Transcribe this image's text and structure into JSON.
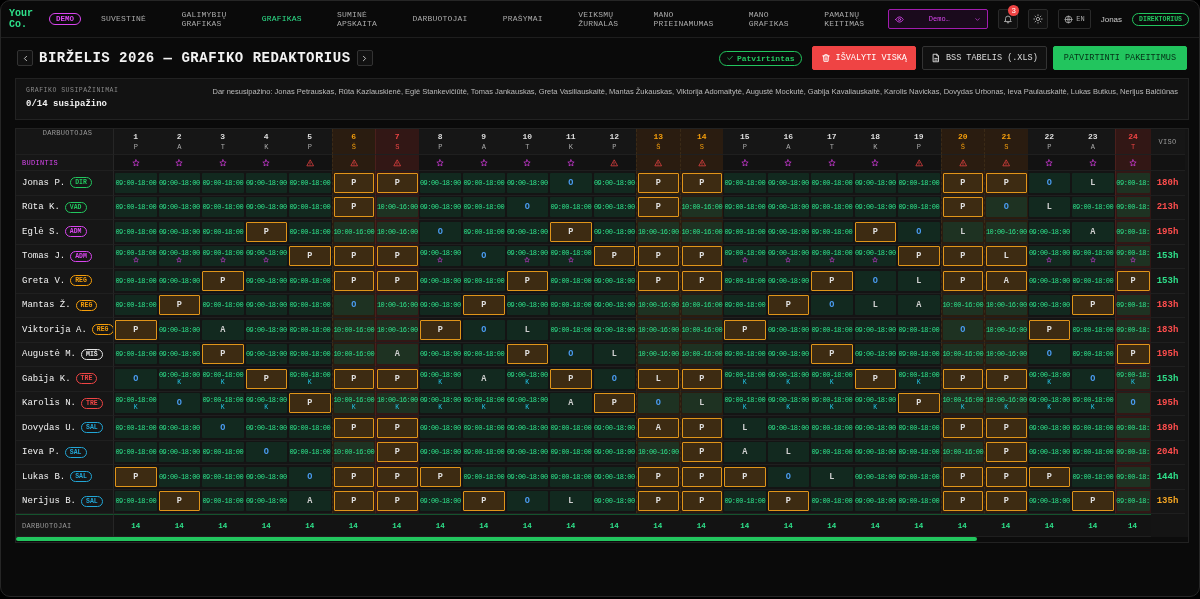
{
  "nav": {
    "logo": "Your Co.",
    "demo_badge": "DEMO",
    "items": [
      {
        "label": "SUVESTINĖ",
        "selected": false
      },
      {
        "label": "GALIMYBIŲ GRAFIKAS",
        "selected": false
      },
      {
        "label": "GRAFIKAS",
        "selected": true
      },
      {
        "label": "SUMINĖ APSKAITA",
        "selected": false
      },
      {
        "label": "DARBUOTOJAI",
        "selected": false
      },
      {
        "label": "PRAŠYMAI",
        "selected": false
      },
      {
        "label": "VEIKSMŲ ŽURNALAS",
        "selected": false
      },
      {
        "label": "MANO PRIEINAMUMAS",
        "selected": false
      },
      {
        "label": "MANO GRAFIKAS",
        "selected": false
      },
      {
        "label": "PAMAINŲ KEITIMAS",
        "selected": false
      }
    ],
    "workspace": "Demo…",
    "notifications": "3",
    "language": "EN",
    "user": "Jonas",
    "role": "DIREKTORIUS"
  },
  "header": {
    "title": "BIRŽELIS 2026 — GRAFIKO REDAKTORIUS",
    "status": "Patvirtintas",
    "buttons": [
      {
        "label": "IŠVALYTI VISKĄ",
        "kind": "danger"
      },
      {
        "label": "BSS TABELIS (.XLS)",
        "kind": "export"
      },
      {
        "label": "PATVIRTINTI PAKEITIMUS",
        "kind": "primary"
      }
    ]
  },
  "acknowledgements": {
    "title": "GRAFIKO SUSIPAŽINIMAI",
    "count": "0/14 susipažino",
    "pending": "Dar nesusipažino: Jonas Petrauskas, Rūta Kazlauskienė, Eglė Stankevičiūtė, Tomas Jankauskas, Greta Vasiliauskaitė, Mantas Žukauskas, Viktorija Adomaitytė, Augustė Mockutė, Gabija Kavaliauskaitė, Karolis Navickas, Dovydas Urbonas, Ieva Paulauskaitė, Lukas Butkus, Nerijus Balčiūnas"
  },
  "grid": {
    "name_header": "DARBUOTOJAS",
    "total_header": "VISO",
    "duty_label": "BUDINTIS",
    "footer_label": "DARBUOTOJAI",
    "days": [
      {
        "number": "1",
        "weekday": "P",
        "kind": "workday",
        "duty": {
          "kind": "star"
        }
      },
      {
        "number": "2",
        "weekday": "A",
        "kind": "workday",
        "duty": {
          "kind": "star"
        }
      },
      {
        "number": "3",
        "weekday": "T",
        "kind": "workday",
        "duty": {
          "kind": "star"
        }
      },
      {
        "number": "4",
        "weekday": "K",
        "kind": "workday",
        "duty": {
          "kind": "star"
        }
      },
      {
        "number": "5",
        "weekday": "P",
        "kind": "workday",
        "duty": {
          "kind": "warning"
        }
      },
      {
        "number": "6",
        "weekday": "Š",
        "kind": "weekend",
        "duty": {
          "kind": "warning"
        }
      },
      {
        "number": "7",
        "weekday": "S",
        "kind": "holiday",
        "duty": {
          "kind": "warning"
        }
      },
      {
        "number": "8",
        "weekday": "P",
        "kind": "workday",
        "duty": {
          "kind": "star"
        }
      },
      {
        "number": "9",
        "weekday": "A",
        "kind": "workday",
        "duty": {
          "kind": "star"
        }
      },
      {
        "number": "10",
        "weekday": "T",
        "kind": "workday",
        "duty": {
          "kind": "star"
        }
      },
      {
        "number": "11",
        "weekday": "K",
        "kind": "workday",
        "duty": {
          "kind": "star"
        }
      },
      {
        "number": "12",
        "weekday": "P",
        "kind": "workday",
        "duty": {
          "kind": "warning"
        }
      },
      {
        "number": "13",
        "weekday": "Š",
        "kind": "weekend",
        "duty": {
          "kind": "warning"
        }
      },
      {
        "number": "14",
        "weekday": "S",
        "kind": "weekend",
        "duty": {
          "kind": "warning"
        }
      },
      {
        "number": "15",
        "weekday": "P",
        "kind": "workday",
        "duty": {
          "kind": "star"
        }
      },
      {
        "number": "16",
        "weekday": "A",
        "kind": "workday",
        "duty": {
          "kind": "star"
        }
      },
      {
        "number": "17",
        "weekday": "T",
        "kind": "workday",
        "duty": {
          "kind": "star"
        }
      },
      {
        "number": "18",
        "weekday": "K",
        "kind": "workday",
        "duty": {
          "kind": "star"
        }
      },
      {
        "number": "19",
        "weekday": "P",
        "kind": "workday",
        "duty": {
          "kind": "warning"
        }
      },
      {
        "number": "20",
        "weekday": "Š",
        "kind": "weekend",
        "duty": {
          "kind": "warning"
        }
      },
      {
        "number": "21",
        "weekday": "S",
        "kind": "weekend",
        "duty": {
          "kind": "warning"
        }
      },
      {
        "number": "22",
        "weekday": "P",
        "kind": "workday",
        "duty": {
          "kind": "star"
        }
      },
      {
        "number": "23",
        "weekday": "A",
        "kind": "workday",
        "duty": {
          "kind": "star"
        }
      },
      {
        "number": "24",
        "weekday": "T",
        "kind": "holiday",
        "duty": {
          "kind": "star"
        }
      }
    ],
    "rows": [
      {
        "name": "Jonas P.",
        "duty": false,
        "role": {
          "label": "DIR",
          "color": "#22c55e"
        },
        "total": {
          "text": "180h",
          "color": "#ff4d4d"
        },
        "cells": [
          {
            "text": "09:00-18:00",
            "kind": "shift"
          },
          {
            "text": "09:00-18:00",
            "kind": "shift"
          },
          {
            "text": "09:00-18:00",
            "kind": "shift"
          },
          {
            "text": "09:00-18:00",
            "kind": "shift"
          },
          {
            "text": "09:00-18:00",
            "kind": "shift"
          },
          {
            "text": "P",
            "kind": "request"
          },
          {
            "text": "P",
            "kind": "request"
          },
          {
            "text": "09:00-18:00",
            "kind": "shift"
          },
          {
            "text": "09:00-18:00",
            "kind": "shift"
          },
          {
            "text": "09:00-18:00",
            "kind": "shift"
          },
          {
            "text": "O",
            "kind": "off"
          },
          {
            "text": "09:00-18:00",
            "kind": "shift"
          },
          {
            "text": "P",
            "kind": "request"
          },
          {
            "text": "P",
            "kind": "request"
          },
          {
            "text": "09:00-18:00",
            "kind": "shift"
          },
          {
            "text": "09:00-18:00",
            "kind": "shift"
          },
          {
            "text": "09:00-18:00",
            "kind": "shift"
          },
          {
            "text": "09:00-18:00",
            "kind": "shift"
          },
          {
            "text": "09:00-18:00",
            "kind": "shift"
          },
          {
            "text": "P",
            "kind": "request"
          },
          {
            "text": "P",
            "kind": "request"
          },
          {
            "text": "O",
            "kind": "off"
          },
          {
            "text": "L",
            "kind": "letter"
          },
          {
            "text": "09:00-18:",
            "kind": "shift"
          }
        ]
      },
      {
        "name": "Rūta K.",
        "duty": false,
        "role": {
          "label": "VAD",
          "color": "#22c55e"
        },
        "total": {
          "text": "213h",
          "color": "#ff4d4d"
        },
        "cells": [
          {
            "text": "09:00-18:00",
            "kind": "shift"
          },
          {
            "text": "09:00-18:00",
            "kind": "shift"
          },
          {
            "text": "09:00-18:00",
            "kind": "shift"
          },
          {
            "text": "09:00-18:00",
            "kind": "shift"
          },
          {
            "text": "09:00-18:00",
            "kind": "shift"
          },
          {
            "text": "P",
            "kind": "request"
          },
          {
            "text": "10:00-16:00",
            "kind": "shift"
          },
          {
            "text": "09:00-18:00",
            "kind": "shift"
          },
          {
            "text": "09:00-18:00",
            "kind": "shift"
          },
          {
            "text": "O",
            "kind": "off"
          },
          {
            "text": "09:00-18:00",
            "kind": "shift"
          },
          {
            "text": "09:00-18:00",
            "kind": "shift"
          },
          {
            "text": "P",
            "kind": "request"
          },
          {
            "text": "10:00-16:00",
            "kind": "shift"
          },
          {
            "text": "09:00-18:00",
            "kind": "shift"
          },
          {
            "text": "09:00-18:00",
            "kind": "shift"
          },
          {
            "text": "09:00-18:00",
            "kind": "shift"
          },
          {
            "text": "09:00-18:00",
            "kind": "shift"
          },
          {
            "text": "09:00-18:00",
            "kind": "shift"
          },
          {
            "text": "P",
            "kind": "request"
          },
          {
            "text": "O",
            "kind": "off"
          },
          {
            "text": "L",
            "kind": "letter"
          },
          {
            "text": "09:00-18:00",
            "kind": "shift"
          },
          {
            "text": "09:00-18:",
            "kind": "shift"
          }
        ]
      },
      {
        "name": "Eglė S.",
        "duty": false,
        "role": {
          "label": "ADM",
          "color": "#d946ef"
        },
        "total": {
          "text": "195h",
          "color": "#ff4d4d"
        },
        "cells": [
          {
            "text": "09:00-18:00",
            "kind": "shift"
          },
          {
            "text": "09:00-18:00",
            "kind": "shift"
          },
          {
            "text": "09:00-18:00",
            "kind": "shift"
          },
          {
            "text": "P",
            "kind": "request"
          },
          {
            "text": "09:00-18:00",
            "kind": "shift"
          },
          {
            "text": "10:00-16:00",
            "kind": "shift"
          },
          {
            "text": "10:00-16:00",
            "kind": "shift"
          },
          {
            "text": "O",
            "kind": "off"
          },
          {
            "text": "09:00-18:00",
            "kind": "shift"
          },
          {
            "text": "09:00-18:00",
            "kind": "shift"
          },
          {
            "text": "P",
            "kind": "request"
          },
          {
            "text": "09:00-18:00",
            "kind": "shift"
          },
          {
            "text": "10:00-16:00",
            "kind": "shift"
          },
          {
            "text": "10:00-16:00",
            "kind": "shift"
          },
          {
            "text": "09:00-18:00",
            "kind": "shift"
          },
          {
            "text": "09:00-18:00",
            "kind": "shift"
          },
          {
            "text": "09:00-18:00",
            "kind": "shift"
          },
          {
            "text": "P",
            "kind": "request"
          },
          {
            "text": "O",
            "kind": "off"
          },
          {
            "text": "L",
            "kind": "letter"
          },
          {
            "text": "10:00-16:00",
            "kind": "shift"
          },
          {
            "text": "09:00-18:00",
            "kind": "shift"
          },
          {
            "text": "A",
            "kind": "letter"
          },
          {
            "text": "09:00-18:",
            "kind": "shift"
          }
        ]
      },
      {
        "name": "Tomas J.",
        "duty": true,
        "role": {
          "label": "ADM",
          "color": "#d946ef"
        },
        "total": {
          "text": "153h",
          "color": "#2ee08a"
        },
        "cells": [
          {
            "text": "09:00-18:00",
            "kind": "shift"
          },
          {
            "text": "09:00-18:00",
            "kind": "shift"
          },
          {
            "text": "09:00-18:00",
            "kind": "shift"
          },
          {
            "text": "09:00-18:00",
            "kind": "shift"
          },
          {
            "text": "P",
            "kind": "request"
          },
          {
            "text": "P",
            "kind": "request"
          },
          {
            "text": "P",
            "kind": "request"
          },
          {
            "text": "09:00-18:00",
            "kind": "shift"
          },
          {
            "text": "O",
            "kind": "off"
          },
          {
            "text": "09:00-18:00",
            "kind": "shift"
          },
          {
            "text": "09:00-18:00",
            "kind": "shift"
          },
          {
            "text": "P",
            "kind": "request"
          },
          {
            "text": "P",
            "kind": "request"
          },
          {
            "text": "P",
            "kind": "request"
          },
          {
            "text": "09:00-18:00",
            "kind": "shift"
          },
          {
            "text": "09:00-18:00",
            "kind": "shift"
          },
          {
            "text": "09:00-18:00",
            "kind": "shift"
          },
          {
            "text": "09:00-18:00",
            "kind": "shift"
          },
          {
            "text": "P",
            "kind": "request"
          },
          {
            "text": "P",
            "kind": "request"
          },
          {
            "text": "L",
            "kind": "request"
          },
          {
            "text": "09:00-18:00",
            "kind": "shift"
          },
          {
            "text": "09:00-18:00",
            "kind": "shift"
          },
          {
            "text": "09:00-18:",
            "kind": "shift"
          }
        ]
      },
      {
        "name": "Greta V.",
        "duty": false,
        "role": {
          "label": "REG",
          "color": "#f59e0b"
        },
        "total": {
          "text": "153h",
          "color": "#2ee08a"
        },
        "cells": [
          {
            "text": "09:00-18:00",
            "kind": "shift"
          },
          {
            "text": "09:00-18:00",
            "kind": "shift"
          },
          {
            "text": "P",
            "kind": "request"
          },
          {
            "text": "09:00-18:00",
            "kind": "shift"
          },
          {
            "text": "09:00-18:00",
            "kind": "shift"
          },
          {
            "text": "P",
            "kind": "request"
          },
          {
            "text": "P",
            "kind": "request"
          },
          {
            "text": "09:00-18:00",
            "kind": "shift"
          },
          {
            "text": "09:00-18:00",
            "kind": "shift"
          },
          {
            "text": "P",
            "kind": "request"
          },
          {
            "text": "09:00-18:00",
            "kind": "shift"
          },
          {
            "text": "09:00-18:00",
            "kind": "shift"
          },
          {
            "text": "P",
            "kind": "request"
          },
          {
            "text": "P",
            "kind": "request"
          },
          {
            "text": "09:00-18:00",
            "kind": "shift"
          },
          {
            "text": "09:00-18:00",
            "kind": "shift"
          },
          {
            "text": "P",
            "kind": "request"
          },
          {
            "text": "O",
            "kind": "off"
          },
          {
            "text": "L",
            "kind": "letter"
          },
          {
            "text": "P",
            "kind": "request"
          },
          {
            "text": "A",
            "kind": "request"
          },
          {
            "text": "09:00-18:00",
            "kind": "shift"
          },
          {
            "text": "09:00-18:00",
            "kind": "shift"
          },
          {
            "text": "P",
            "kind": "request"
          }
        ]
      },
      {
        "name": "Mantas Ž.",
        "duty": false,
        "role": {
          "label": "REG",
          "color": "#f59e0b"
        },
        "total": {
          "text": "183h",
          "color": "#ff4d4d"
        },
        "cells": [
          {
            "text": "09:00-18:00",
            "kind": "shift"
          },
          {
            "text": "P",
            "kind": "request"
          },
          {
            "text": "09:00-18:00",
            "kind": "shift"
          },
          {
            "text": "09:00-18:00",
            "kind": "shift"
          },
          {
            "text": "09:00-18:00",
            "kind": "shift"
          },
          {
            "text": "O",
            "kind": "off"
          },
          {
            "text": "10:00-16:00",
            "kind": "shift"
          },
          {
            "text": "09:00-18:00",
            "kind": "shift"
          },
          {
            "text": "P",
            "kind": "request"
          },
          {
            "text": "09:00-18:00",
            "kind": "shift"
          },
          {
            "text": "09:00-18:00",
            "kind": "shift"
          },
          {
            "text": "09:00-18:00",
            "kind": "shift"
          },
          {
            "text": "10:00-16:00",
            "kind": "shift"
          },
          {
            "text": "10:00-16:00",
            "kind": "shift"
          },
          {
            "text": "09:00-18:00",
            "kind": "shift"
          },
          {
            "text": "P",
            "kind": "request"
          },
          {
            "text": "O",
            "kind": "off"
          },
          {
            "text": "L",
            "kind": "letter"
          },
          {
            "text": "A",
            "kind": "letter"
          },
          {
            "text": "10:00-16:00",
            "kind": "shift"
          },
          {
            "text": "10:00-16:00",
            "kind": "shift"
          },
          {
            "text": "09:00-18:00",
            "kind": "shift"
          },
          {
            "text": "P",
            "kind": "request"
          },
          {
            "text": "09:00-18:",
            "kind": "shift"
          }
        ]
      },
      {
        "name": "Viktorija A.",
        "duty": false,
        "role": {
          "label": "REG",
          "color": "#f59e0b"
        },
        "total": {
          "text": "183h",
          "color": "#ff4d4d"
        },
        "cells": [
          {
            "text": "P",
            "kind": "request"
          },
          {
            "text": "09:00-18:00",
            "kind": "shift"
          },
          {
            "text": "A",
            "kind": "letter"
          },
          {
            "text": "09:00-18:00",
            "kind": "shift"
          },
          {
            "text": "09:00-18:00",
            "kind": "shift"
          },
          {
            "text": "10:00-16:00",
            "kind": "shift"
          },
          {
            "text": "10:00-16:00",
            "kind": "shift"
          },
          {
            "text": "P",
            "kind": "request"
          },
          {
            "text": "O",
            "kind": "off"
          },
          {
            "text": "L",
            "kind": "letter"
          },
          {
            "text": "09:00-18:00",
            "kind": "shift"
          },
          {
            "text": "09:00-18:00",
            "kind": "shift"
          },
          {
            "text": "10:00-16:00",
            "kind": "shift"
          },
          {
            "text": "10:00-16:00",
            "kind": "shift"
          },
          {
            "text": "P",
            "kind": "request"
          },
          {
            "text": "09:00-18:00",
            "kind": "shift"
          },
          {
            "text": "09:00-18:00",
            "kind": "shift"
          },
          {
            "text": "09:00-18:00",
            "kind": "shift"
          },
          {
            "text": "09:00-18:00",
            "kind": "shift"
          },
          {
            "text": "O",
            "kind": "off"
          },
          {
            "text": "10:00-16:00",
            "kind": "shift"
          },
          {
            "text": "P",
            "kind": "request"
          },
          {
            "text": "09:00-18:00",
            "kind": "shift"
          },
          {
            "text": "09:00-18:",
            "kind": "shift"
          }
        ]
      },
      {
        "name": "Augustė M.",
        "duty": false,
        "role": {
          "label": "MIŠ",
          "color": "#e5e5e5"
        },
        "total": {
          "text": "195h",
          "color": "#ff4d4d"
        },
        "cells": [
          {
            "text": "09:00-18:00",
            "kind": "shift"
          },
          {
            "text": "09:00-18:00",
            "kind": "shift"
          },
          {
            "text": "P",
            "kind": "request"
          },
          {
            "text": "09:00-18:00",
            "kind": "shift"
          },
          {
            "text": "09:00-18:00",
            "kind": "shift"
          },
          {
            "text": "10:00-16:00",
            "kind": "shift"
          },
          {
            "text": "A",
            "kind": "letter"
          },
          {
            "text": "09:00-18:00",
            "kind": "shift"
          },
          {
            "text": "09:00-18:00",
            "kind": "shift"
          },
          {
            "text": "P",
            "kind": "request"
          },
          {
            "text": "O",
            "kind": "off"
          },
          {
            "text": "L",
            "kind": "letter"
          },
          {
            "text": "10:00-16:00",
            "kind": "shift"
          },
          {
            "text": "10:00-16:00",
            "kind": "shift"
          },
          {
            "text": "09:00-18:00",
            "kind": "shift"
          },
          {
            "text": "09:00-18:00",
            "kind": "shift"
          },
          {
            "text": "P",
            "kind": "request"
          },
          {
            "text": "09:00-18:00",
            "kind": "shift"
          },
          {
            "text": "09:00-18:00",
            "kind": "shift"
          },
          {
            "text": "10:00-16:00",
            "kind": "shift"
          },
          {
            "text": "10:00-16:00",
            "kind": "shift"
          },
          {
            "text": "O",
            "kind": "off"
          },
          {
            "text": "09:00-18:00",
            "kind": "shift"
          },
          {
            "text": "P",
            "kind": "request"
          }
        ]
      },
      {
        "name": "Gabija K.",
        "duty": false,
        "role": {
          "label": "TRE",
          "color": "#ef4444"
        },
        "total": {
          "text": "153h",
          "color": "#2ee08a"
        },
        "cells": [
          {
            "text": "O",
            "kind": "off"
          },
          {
            "text": "09:00-18:00",
            "kind": "shift",
            "note": "K"
          },
          {
            "text": "09:00-18:00",
            "kind": "shift",
            "note": "K"
          },
          {
            "text": "P",
            "kind": "request"
          },
          {
            "text": "09:00-18:00",
            "kind": "shift",
            "note": "K"
          },
          {
            "text": "P",
            "kind": "request"
          },
          {
            "text": "P",
            "kind": "request"
          },
          {
            "text": "09:00-18:00",
            "kind": "shift",
            "note": "K"
          },
          {
            "text": "A",
            "kind": "letter"
          },
          {
            "text": "09:00-18:00",
            "kind": "shift",
            "note": "K"
          },
          {
            "text": "P",
            "kind": "request"
          },
          {
            "text": "O",
            "kind": "off"
          },
          {
            "text": "L",
            "kind": "request"
          },
          {
            "text": "P",
            "kind": "request"
          },
          {
            "text": "09:00-18:00",
            "kind": "shift",
            "note": "K"
          },
          {
            "text": "09:00-18:00",
            "kind": "shift",
            "note": "K"
          },
          {
            "text": "09:00-18:00",
            "kind": "shift",
            "note": "K"
          },
          {
            "text": "P",
            "kind": "request"
          },
          {
            "text": "09:00-18:00",
            "kind": "shift",
            "note": "K"
          },
          {
            "text": "P",
            "kind": "request"
          },
          {
            "text": "P",
            "kind": "request"
          },
          {
            "text": "09:00-18:00",
            "kind": "shift",
            "note": "K"
          },
          {
            "text": "O",
            "kind": "off"
          },
          {
            "text": "09:00-18:",
            "kind": "shift",
            "note": "K"
          }
        ]
      },
      {
        "name": "Karolis N.",
        "duty": false,
        "role": {
          "label": "TRE",
          "color": "#ef4444"
        },
        "total": {
          "text": "195h",
          "color": "#ff4d4d"
        },
        "cells": [
          {
            "text": "09:00-18:00",
            "kind": "shift",
            "note": "K"
          },
          {
            "text": "O",
            "kind": "off"
          },
          {
            "text": "09:00-18:00",
            "kind": "shift",
            "note": "K"
          },
          {
            "text": "09:00-18:00",
            "kind": "shift",
            "note": "K"
          },
          {
            "text": "P",
            "kind": "request"
          },
          {
            "text": "10:00-16:00",
            "kind": "shift",
            "note": "K"
          },
          {
            "text": "10:00-16:00",
            "kind": "shift",
            "note": "K"
          },
          {
            "text": "09:00-18:00",
            "kind": "shift",
            "note": "K"
          },
          {
            "text": "09:00-18:00",
            "kind": "shift",
            "note": "K"
          },
          {
            "text": "09:00-18:00",
            "kind": "shift",
            "note": "K"
          },
          {
            "text": "A",
            "kind": "letter"
          },
          {
            "text": "P",
            "kind": "request"
          },
          {
            "text": "O",
            "kind": "off"
          },
          {
            "text": "L",
            "kind": "letter"
          },
          {
            "text": "09:00-18:00",
            "kind": "shift",
            "note": "K"
          },
          {
            "text": "09:00-18:00",
            "kind": "shift",
            "note": "K"
          },
          {
            "text": "09:00-18:00",
            "kind": "shift",
            "note": "K"
          },
          {
            "text": "09:00-18:00",
            "kind": "shift",
            "note": "K"
          },
          {
            "text": "P",
            "kind": "request"
          },
          {
            "text": "10:00-16:00",
            "kind": "shift",
            "note": "K"
          },
          {
            "text": "10:00-16:00",
            "kind": "shift",
            "note": "K"
          },
          {
            "text": "09:00-18:00",
            "kind": "shift",
            "note": "K"
          },
          {
            "text": "09:00-18:00",
            "kind": "shift",
            "note": "K"
          },
          {
            "text": "O",
            "kind": "off"
          }
        ]
      },
      {
        "name": "Dovydas U.",
        "duty": false,
        "role": {
          "label": "SAL",
          "color": "#22a6d6"
        },
        "total": {
          "text": "189h",
          "color": "#ff4d4d"
        },
        "cells": [
          {
            "text": "09:00-18:00",
            "kind": "shift"
          },
          {
            "text": "09:00-18:00",
            "kind": "shift"
          },
          {
            "text": "O",
            "kind": "off"
          },
          {
            "text": "09:00-18:00",
            "kind": "shift"
          },
          {
            "text": "09:00-18:00",
            "kind": "shift"
          },
          {
            "text": "P",
            "kind": "request"
          },
          {
            "text": "P",
            "kind": "request"
          },
          {
            "text": "09:00-18:00",
            "kind": "shift"
          },
          {
            "text": "09:00-18:00",
            "kind": "shift"
          },
          {
            "text": "09:00-18:00",
            "kind": "shift"
          },
          {
            "text": "09:00-18:00",
            "kind": "shift"
          },
          {
            "text": "09:00-18:00",
            "kind": "shift"
          },
          {
            "text": "A",
            "kind": "request"
          },
          {
            "text": "P",
            "kind": "request"
          },
          {
            "text": "L",
            "kind": "letter"
          },
          {
            "text": "09:00-18:00",
            "kind": "shift"
          },
          {
            "text": "09:00-18:00",
            "kind": "shift"
          },
          {
            "text": "09:00-18:00",
            "kind": "shift"
          },
          {
            "text": "09:00-18:00",
            "kind": "shift"
          },
          {
            "text": "P",
            "kind": "request"
          },
          {
            "text": "P",
            "kind": "request"
          },
          {
            "text": "09:00-18:00",
            "kind": "shift"
          },
          {
            "text": "09:00-18:00",
            "kind": "shift"
          },
          {
            "text": "09:00-18:",
            "kind": "shift"
          }
        ]
      },
      {
        "name": "Ieva P.",
        "duty": false,
        "role": {
          "label": "SAL",
          "color": "#22a6d6"
        },
        "total": {
          "text": "204h",
          "color": "#ff4d4d"
        },
        "cells": [
          {
            "text": "09:00-18:00",
            "kind": "shift"
          },
          {
            "text": "09:00-18:00",
            "kind": "shift"
          },
          {
            "text": "09:00-18:00",
            "kind": "shift"
          },
          {
            "text": "O",
            "kind": "off"
          },
          {
            "text": "09:00-18:00",
            "kind": "shift"
          },
          {
            "text": "10:00-16:00",
            "kind": "shift"
          },
          {
            "text": "P",
            "kind": "request"
          },
          {
            "text": "09:00-18:00",
            "kind": "shift"
          },
          {
            "text": "09:00-18:00",
            "kind": "shift"
          },
          {
            "text": "09:00-18:00",
            "kind": "shift"
          },
          {
            "text": "09:00-18:00",
            "kind": "shift"
          },
          {
            "text": "09:00-18:00",
            "kind": "shift"
          },
          {
            "text": "10:00-16:00",
            "kind": "shift"
          },
          {
            "text": "P",
            "kind": "request"
          },
          {
            "text": "A",
            "kind": "letter"
          },
          {
            "text": "L",
            "kind": "letter"
          },
          {
            "text": "09:00-18:00",
            "kind": "shift"
          },
          {
            "text": "09:00-18:00",
            "kind": "shift"
          },
          {
            "text": "09:00-18:00",
            "kind": "shift"
          },
          {
            "text": "10:00-16:00",
            "kind": "shift"
          },
          {
            "text": "P",
            "kind": "request"
          },
          {
            "text": "09:00-18:00",
            "kind": "shift"
          },
          {
            "text": "09:00-18:00",
            "kind": "shift"
          },
          {
            "text": "09:00-18:",
            "kind": "shift"
          }
        ]
      },
      {
        "name": "Lukas B.",
        "duty": false,
        "role": {
          "label": "SAL",
          "color": "#22a6d6"
        },
        "total": {
          "text": "144h",
          "color": "#2ee08a"
        },
        "cells": [
          {
            "text": "P",
            "kind": "request"
          },
          {
            "text": "09:00-18:00",
            "kind": "shift"
          },
          {
            "text": "09:00-18:00",
            "kind": "shift"
          },
          {
            "text": "09:00-18:00",
            "kind": "shift"
          },
          {
            "text": "O",
            "kind": "off"
          },
          {
            "text": "P",
            "kind": "request"
          },
          {
            "text": "P",
            "kind": "request"
          },
          {
            "text": "P",
            "kind": "request"
          },
          {
            "text": "09:00-18:00",
            "kind": "shift"
          },
          {
            "text": "09:00-18:00",
            "kind": "shift"
          },
          {
            "text": "09:00-18:00",
            "kind": "shift"
          },
          {
            "text": "09:00-18:00",
            "kind": "shift"
          },
          {
            "text": "P",
            "kind": "request"
          },
          {
            "text": "P",
            "kind": "request"
          },
          {
            "text": "P",
            "kind": "request"
          },
          {
            "text": "O",
            "kind": "off"
          },
          {
            "text": "L",
            "kind": "letter"
          },
          {
            "text": "09:00-18:00",
            "kind": "shift"
          },
          {
            "text": "09:00-18:00",
            "kind": "shift"
          },
          {
            "text": "P",
            "kind": "request"
          },
          {
            "text": "P",
            "kind": "request"
          },
          {
            "text": "P",
            "kind": "request"
          },
          {
            "text": "09:00-18:00",
            "kind": "shift"
          },
          {
            "text": "09:00-18:",
            "kind": "shift"
          }
        ]
      },
      {
        "name": "Nerijus B.",
        "duty": false,
        "role": {
          "label": "SAL",
          "color": "#22a6d6"
        },
        "total": {
          "text": "135h",
          "color": "#f5a623"
        },
        "cells": [
          {
            "text": "09:00-18:00",
            "kind": "shift"
          },
          {
            "text": "P",
            "kind": "request"
          },
          {
            "text": "09:00-18:00",
            "kind": "shift"
          },
          {
            "text": "09:00-18:00",
            "kind": "shift"
          },
          {
            "text": "A",
            "kind": "letter"
          },
          {
            "text": "P",
            "kind": "request"
          },
          {
            "text": "P",
            "kind": "request"
          },
          {
            "text": "09:00-18:00",
            "kind": "shift"
          },
          {
            "text": "P",
            "kind": "request"
          },
          {
            "text": "O",
            "kind": "off"
          },
          {
            "text": "L",
            "kind": "letter"
          },
          {
            "text": "09:00-18:00",
            "kind": "shift"
          },
          {
            "text": "P",
            "kind": "request"
          },
          {
            "text": "P",
            "kind": "request"
          },
          {
            "text": "09:00-18:00",
            "kind": "shift"
          },
          {
            "text": "P",
            "kind": "request"
          },
          {
            "text": "09:00-18:00",
            "kind": "shift"
          },
          {
            "text": "09:00-18:00",
            "kind": "shift"
          },
          {
            "text": "09:00-18:00",
            "kind": "shift"
          },
          {
            "text": "P",
            "kind": "request"
          },
          {
            "text": "P",
            "kind": "request"
          },
          {
            "text": "09:00-18:00",
            "kind": "shift"
          },
          {
            "text": "P",
            "kind": "request"
          },
          {
            "text": "09:00-18:",
            "kind": "shift"
          }
        ]
      }
    ],
    "footer_counts": [
      "14",
      "14",
      "14",
      "14",
      "14",
      "14",
      "14",
      "14",
      "14",
      "14",
      "14",
      "14",
      "14",
      "14",
      "14",
      "14",
      "14",
      "14",
      "14",
      "14",
      "14",
      "14",
      "14",
      "14"
    ]
  }
}
